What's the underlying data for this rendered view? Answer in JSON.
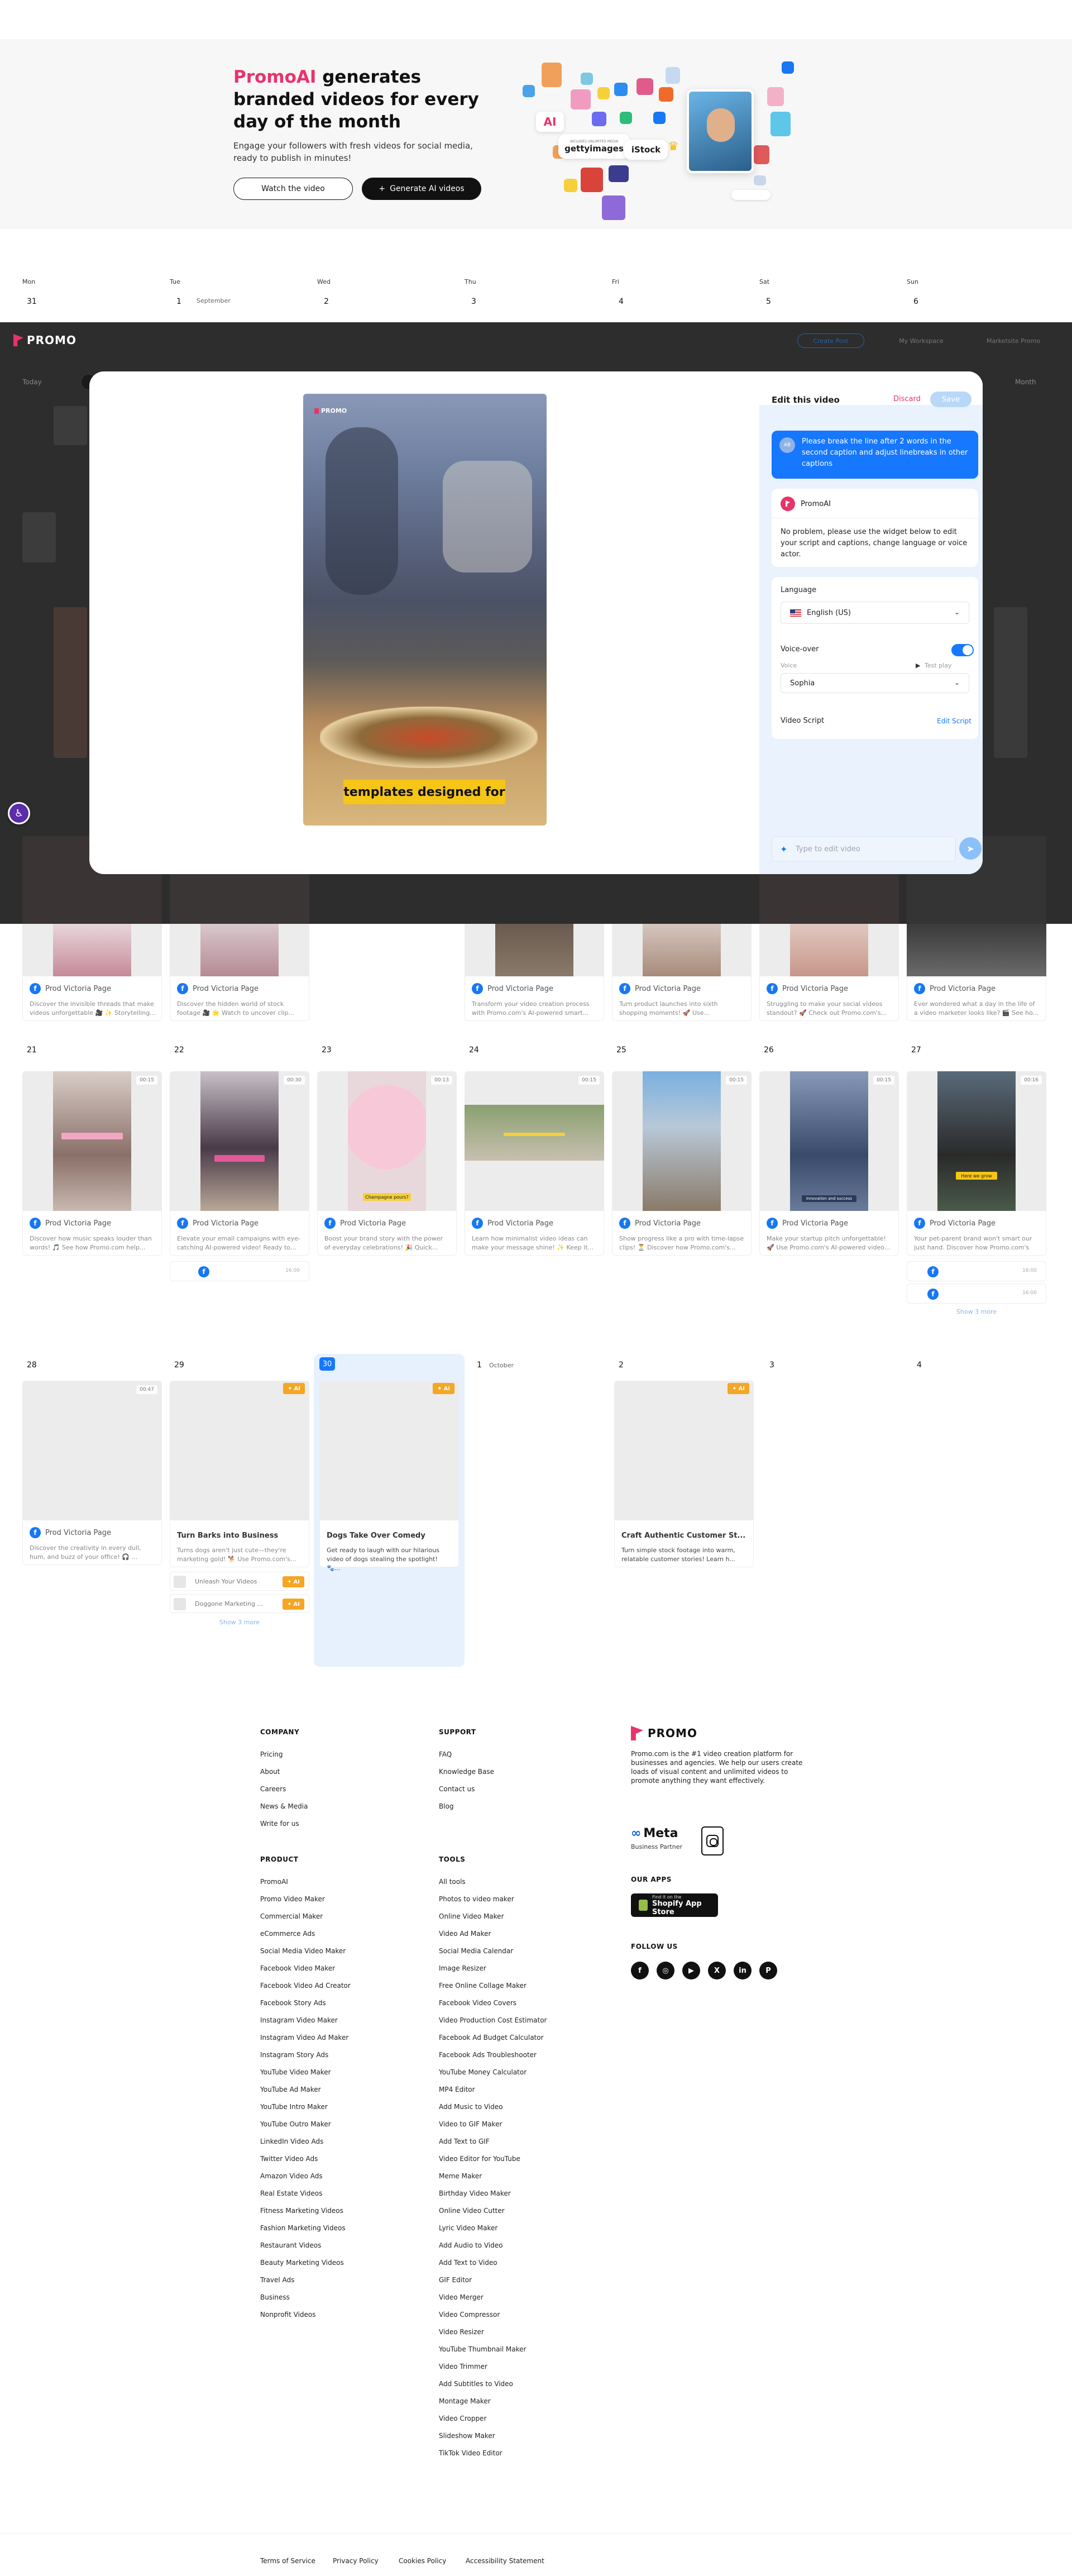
{
  "hero": {
    "brand": "PromoAI",
    "title_rest": " generates branded videos for every day of the month",
    "subtitle": "Engage your followers with fresh videos for social media, ready to publish in minutes!",
    "watch_btn": "Watch the video",
    "generate_btn": "Generate AI videos",
    "chips": {
      "ai": "AI",
      "getty": "gettyimages",
      "getty_small": "INCLUDES UNLIMITED MEDIA",
      "istock": "iStock"
    }
  },
  "calendar": {
    "days": [
      "Mon",
      "Tue",
      "Wed",
      "Thu",
      "Fri",
      "Sat",
      "Sun"
    ],
    "first_row": [
      "31",
      "1",
      "2",
      "3",
      "4",
      "5",
      "6"
    ],
    "first_row_month": "September",
    "week3": [
      "21",
      "22",
      "23",
      "24",
      "25",
      "26",
      "27"
    ],
    "week4": [
      "28",
      "29",
      "30",
      "1",
      "2",
      "3",
      "4"
    ],
    "week4_month": "October",
    "page_name": "Prod Victoria Page",
    "row1_desc": [
      "Discover the invisible threads that make videos unforgettable 🎥 ✨ Storytelling...",
      "Discover the hidden world of stock footage 🎥 🌟 Watch to uncover clip...",
      "",
      "Transform your video creation process with Promo.com's AI-powered smart...",
      "Turn product launches into sixth shopping moments! 🚀 Use...",
      "Struggling to make your social videos standout? 🚀 Check out Promo.com's...",
      "Ever wondered what a day in the life of a video marketer looks like? 🎬 See ho..."
    ],
    "row2_desc": [
      "Discover how music speaks louder than words! 🎵 See how Promo.com help...",
      "Elevate your email campaigns with eye-catching AI-powered video! Ready to...",
      "Boost your brand story with the power of everyday celebrations! 🎉 Quick...",
      "Learn how minimalist video ideas can make your message shine! ✨ Keep it...",
      "Show progress like a pro with time-lapse clips! ⏳ Discover how Promo.com's...",
      "Make your startup pitch unforgettable! 🚀 Use Promo.com's AI-powered video...",
      "Your pet-parent brand won't smart our just hand. Discover how Promo.com's A..."
    ],
    "row2_durations": [
      "00:15",
      "00:30",
      "00:13",
      "00:15",
      "00:15",
      "00:15",
      "00:16"
    ],
    "row2_captions": [
      "",
      "",
      "Champagne pours?",
      "",
      "",
      "Innovation and success",
      "Here we grow"
    ],
    "mini_time": "16:00",
    "row3_desc": "Discover the creativity in every dull, hum, and buzz of your office! 🎧 ...",
    "row3_duration": "00:47",
    "drafts": [
      {
        "title": "Turn Barks into Business",
        "desc": "Turns dogs aren't just cute—they're marketing gold! 🐕 Use Promo.com's..."
      },
      {
        "title": "Dogs Take Over Comedy",
        "desc": "Get ready to laugh with our hilarious video of dogs stealing the spotlight! 🐾..."
      },
      {
        "title": "Craft Authentic Customer St...",
        "desc": "Turn simple stock footage into warm, relatable customer stories! Learn h..."
      }
    ],
    "draft_items": [
      "Unleash Your Videos",
      "Doggone Marketing ..."
    ],
    "ai_label": "AI",
    "show_more": "Show 3 more"
  },
  "overlay": {
    "logo": "PROMO",
    "create_btn": "Create Post",
    "workspace": "My Workspace",
    "account": "Marketsite Promo",
    "row_label": "Today",
    "month_label": "Month"
  },
  "modal": {
    "video_caption": "templates designed for",
    "video_logo": "PROMO",
    "panel_title": "Edit this video",
    "discard": "Discard",
    "save": "Save",
    "user_initials": "AB",
    "user_message": "Please break the line after 2 words in the second caption and adjust linebreaks in other captions",
    "ai_name": "PromoAI",
    "ai_message": "No problem, please use the widget below to edit your script and captions, change language or voice actor.",
    "language_label": "Language",
    "language_value": "English (US)",
    "voiceover_label": "Voice-over",
    "voice_label": "Voice",
    "test_play": "Test play",
    "voice_value": "Sophia",
    "script_label": "Video Script",
    "edit_script": "Edit Script",
    "input_placeholder": "Type to edit video"
  },
  "footer": {
    "company": {
      "heading": "COMPANY",
      "links": [
        "Pricing",
        "About",
        "Careers",
        "News & Media",
        "Write for us"
      ]
    },
    "support": {
      "heading": "SUPPORT",
      "links": [
        "FAQ",
        "Knowledge Base",
        "Contact us",
        "Blog"
      ]
    },
    "product": {
      "heading": "PRODUCT",
      "links": [
        "PromoAI",
        "Promo Video Maker",
        "Commercial Maker",
        "eCommerce Ads",
        "Social Media Video Maker",
        "Facebook Video Maker",
        "Facebook Video Ad Creator",
        "Facebook Story Ads",
        "Instagram Video Maker",
        "Instagram Video Ad Maker",
        "Instagram Story Ads",
        "YouTube Video Maker",
        "YouTube Ad Maker",
        "YouTube Intro Maker",
        "YouTube Outro Maker",
        "LinkedIn Video Ads",
        "Twitter Video Ads",
        "Amazon Video Ads",
        "Real Estate Videos",
        "Fitness Marketing Videos",
        "Fashion Marketing Videos",
        "Restaurant Videos",
        "Beauty Marketing Videos",
        "Travel Ads",
        "Business",
        "Nonprofit Videos"
      ]
    },
    "tools": {
      "heading": "TOOLS",
      "links": [
        "All tools",
        "Photos to video maker",
        "Online Video Maker",
        "Video Ad Maker",
        "Social Media Calendar",
        "Image Resizer",
        "Free Online Collage Maker",
        "Facebook Video Covers",
        "Video Production Cost Estimator",
        "Facebook Ad Budget Calculator",
        "Facebook Ads Troubleshooter",
        "YouTube Money Calculator",
        "MP4 Editor",
        "Add Music to Video",
        "Video to GIF Maker",
        "Add Text to GIF",
        "Video Editor for YouTube",
        "Meme Maker",
        "Birthday Video Maker",
        "Online Video Cutter",
        "Lyric Video Maker",
        "Add Audio to Video",
        "Add Text to Video",
        "GIF Editor",
        "Video Merger",
        "Video Compressor",
        "Video Resizer",
        "YouTube Thumbnail Maker",
        "Video Trimmer",
        "Add Subtitles to Video",
        "Montage Maker",
        "Video Cropper",
        "Slideshow Maker",
        "TikTok Video Editor"
      ]
    },
    "brand": "PROMO",
    "about": "Promo.com is the #1 video creation platform for businesses and agencies. We help our users create loads of visual content and unlimited videos to promote anything they want effectively.",
    "meta": "Meta",
    "meta_sub": "Business Partner",
    "our_apps": "OUR APPS",
    "shopify_small": "Find it on the",
    "shopify_big": "Shopify App Store",
    "follow_us": "FOLLOW US",
    "socials": [
      "f",
      "◎",
      "▶",
      "X",
      "in",
      "P"
    ],
    "legal": [
      "Terms of Service",
      "Privacy Policy",
      "Cookies Policy",
      "Accessibility Statement"
    ]
  },
  "colors": {
    "brand": "#e8336b",
    "accent": "#1677ff",
    "ai_tag": "#f5a623"
  }
}
